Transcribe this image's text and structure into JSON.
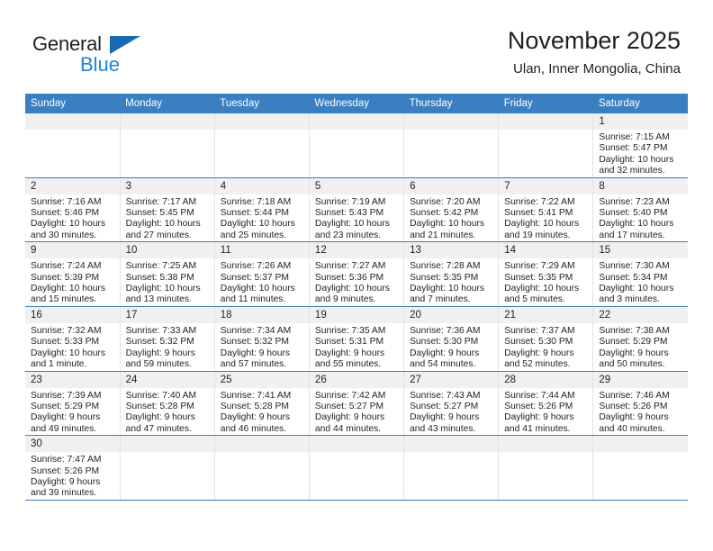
{
  "brand": {
    "name_dark": "General",
    "name_blue": "Blue",
    "accent_blue": "#1869b0",
    "light_blue": "#1f86d0"
  },
  "header": {
    "title": "November 2025",
    "subtitle": "Ulan, Inner Mongolia, China"
  },
  "theme": {
    "header_row_bg": "#3a7fc1",
    "daynum_bg": "#f0f0f0",
    "text": "#231f20"
  },
  "weekdays": [
    "Sunday",
    "Monday",
    "Tuesday",
    "Wednesday",
    "Thursday",
    "Friday",
    "Saturday"
  ],
  "weeks": [
    [
      {
        "day": "",
        "empty": true,
        "sunrise": "",
        "sunset": "",
        "daylight1": "",
        "daylight2": ""
      },
      {
        "day": "",
        "empty": true,
        "sunrise": "",
        "sunset": "",
        "daylight1": "",
        "daylight2": ""
      },
      {
        "day": "",
        "empty": true,
        "sunrise": "",
        "sunset": "",
        "daylight1": "",
        "daylight2": ""
      },
      {
        "day": "",
        "empty": true,
        "sunrise": "",
        "sunset": "",
        "daylight1": "",
        "daylight2": ""
      },
      {
        "day": "",
        "empty": true,
        "sunrise": "",
        "sunset": "",
        "daylight1": "",
        "daylight2": ""
      },
      {
        "day": "",
        "empty": true,
        "sunrise": "",
        "sunset": "",
        "daylight1": "",
        "daylight2": ""
      },
      {
        "day": "1",
        "sunrise": "Sunrise: 7:15 AM",
        "sunset": "Sunset: 5:47 PM",
        "daylight1": "Daylight: 10 hours",
        "daylight2": "and 32 minutes."
      }
    ],
    [
      {
        "day": "2",
        "sunrise": "Sunrise: 7:16 AM",
        "sunset": "Sunset: 5:46 PM",
        "daylight1": "Daylight: 10 hours",
        "daylight2": "and 30 minutes."
      },
      {
        "day": "3",
        "sunrise": "Sunrise: 7:17 AM",
        "sunset": "Sunset: 5:45 PM",
        "daylight1": "Daylight: 10 hours",
        "daylight2": "and 27 minutes."
      },
      {
        "day": "4",
        "sunrise": "Sunrise: 7:18 AM",
        "sunset": "Sunset: 5:44 PM",
        "daylight1": "Daylight: 10 hours",
        "daylight2": "and 25 minutes."
      },
      {
        "day": "5",
        "sunrise": "Sunrise: 7:19 AM",
        "sunset": "Sunset: 5:43 PM",
        "daylight1": "Daylight: 10 hours",
        "daylight2": "and 23 minutes."
      },
      {
        "day": "6",
        "sunrise": "Sunrise: 7:20 AM",
        "sunset": "Sunset: 5:42 PM",
        "daylight1": "Daylight: 10 hours",
        "daylight2": "and 21 minutes."
      },
      {
        "day": "7",
        "sunrise": "Sunrise: 7:22 AM",
        "sunset": "Sunset: 5:41 PM",
        "daylight1": "Daylight: 10 hours",
        "daylight2": "and 19 minutes."
      },
      {
        "day": "8",
        "sunrise": "Sunrise: 7:23 AM",
        "sunset": "Sunset: 5:40 PM",
        "daylight1": "Daylight: 10 hours",
        "daylight2": "and 17 minutes."
      }
    ],
    [
      {
        "day": "9",
        "sunrise": "Sunrise: 7:24 AM",
        "sunset": "Sunset: 5:39 PM",
        "daylight1": "Daylight: 10 hours",
        "daylight2": "and 15 minutes."
      },
      {
        "day": "10",
        "sunrise": "Sunrise: 7:25 AM",
        "sunset": "Sunset: 5:38 PM",
        "daylight1": "Daylight: 10 hours",
        "daylight2": "and 13 minutes."
      },
      {
        "day": "11",
        "sunrise": "Sunrise: 7:26 AM",
        "sunset": "Sunset: 5:37 PM",
        "daylight1": "Daylight: 10 hours",
        "daylight2": "and 11 minutes."
      },
      {
        "day": "12",
        "sunrise": "Sunrise: 7:27 AM",
        "sunset": "Sunset: 5:36 PM",
        "daylight1": "Daylight: 10 hours",
        "daylight2": "and 9 minutes."
      },
      {
        "day": "13",
        "sunrise": "Sunrise: 7:28 AM",
        "sunset": "Sunset: 5:35 PM",
        "daylight1": "Daylight: 10 hours",
        "daylight2": "and 7 minutes."
      },
      {
        "day": "14",
        "sunrise": "Sunrise: 7:29 AM",
        "sunset": "Sunset: 5:35 PM",
        "daylight1": "Daylight: 10 hours",
        "daylight2": "and 5 minutes."
      },
      {
        "day": "15",
        "sunrise": "Sunrise: 7:30 AM",
        "sunset": "Sunset: 5:34 PM",
        "daylight1": "Daylight: 10 hours",
        "daylight2": "and 3 minutes."
      }
    ],
    [
      {
        "day": "16",
        "sunrise": "Sunrise: 7:32 AM",
        "sunset": "Sunset: 5:33 PM",
        "daylight1": "Daylight: 10 hours",
        "daylight2": "and 1 minute."
      },
      {
        "day": "17",
        "sunrise": "Sunrise: 7:33 AM",
        "sunset": "Sunset: 5:32 PM",
        "daylight1": "Daylight: 9 hours",
        "daylight2": "and 59 minutes."
      },
      {
        "day": "18",
        "sunrise": "Sunrise: 7:34 AM",
        "sunset": "Sunset: 5:32 PM",
        "daylight1": "Daylight: 9 hours",
        "daylight2": "and 57 minutes."
      },
      {
        "day": "19",
        "sunrise": "Sunrise: 7:35 AM",
        "sunset": "Sunset: 5:31 PM",
        "daylight1": "Daylight: 9 hours",
        "daylight2": "and 55 minutes."
      },
      {
        "day": "20",
        "sunrise": "Sunrise: 7:36 AM",
        "sunset": "Sunset: 5:30 PM",
        "daylight1": "Daylight: 9 hours",
        "daylight2": "and 54 minutes."
      },
      {
        "day": "21",
        "sunrise": "Sunrise: 7:37 AM",
        "sunset": "Sunset: 5:30 PM",
        "daylight1": "Daylight: 9 hours",
        "daylight2": "and 52 minutes."
      },
      {
        "day": "22",
        "sunrise": "Sunrise: 7:38 AM",
        "sunset": "Sunset: 5:29 PM",
        "daylight1": "Daylight: 9 hours",
        "daylight2": "and 50 minutes."
      }
    ],
    [
      {
        "day": "23",
        "sunrise": "Sunrise: 7:39 AM",
        "sunset": "Sunset: 5:29 PM",
        "daylight1": "Daylight: 9 hours",
        "daylight2": "and 49 minutes."
      },
      {
        "day": "24",
        "sunrise": "Sunrise: 7:40 AM",
        "sunset": "Sunset: 5:28 PM",
        "daylight1": "Daylight: 9 hours",
        "daylight2": "and 47 minutes."
      },
      {
        "day": "25",
        "sunrise": "Sunrise: 7:41 AM",
        "sunset": "Sunset: 5:28 PM",
        "daylight1": "Daylight: 9 hours",
        "daylight2": "and 46 minutes."
      },
      {
        "day": "26",
        "sunrise": "Sunrise: 7:42 AM",
        "sunset": "Sunset: 5:27 PM",
        "daylight1": "Daylight: 9 hours",
        "daylight2": "and 44 minutes."
      },
      {
        "day": "27",
        "sunrise": "Sunrise: 7:43 AM",
        "sunset": "Sunset: 5:27 PM",
        "daylight1": "Daylight: 9 hours",
        "daylight2": "and 43 minutes."
      },
      {
        "day": "28",
        "sunrise": "Sunrise: 7:44 AM",
        "sunset": "Sunset: 5:26 PM",
        "daylight1": "Daylight: 9 hours",
        "daylight2": "and 41 minutes."
      },
      {
        "day": "29",
        "sunrise": "Sunrise: 7:46 AM",
        "sunset": "Sunset: 5:26 PM",
        "daylight1": "Daylight: 9 hours",
        "daylight2": "and 40 minutes."
      }
    ],
    [
      {
        "day": "30",
        "sunrise": "Sunrise: 7:47 AM",
        "sunset": "Sunset: 5:26 PM",
        "daylight1": "Daylight: 9 hours",
        "daylight2": "and 39 minutes."
      },
      {
        "day": "",
        "empty": true,
        "sunrise": "",
        "sunset": "",
        "daylight1": "",
        "daylight2": ""
      },
      {
        "day": "",
        "empty": true,
        "sunrise": "",
        "sunset": "",
        "daylight1": "",
        "daylight2": ""
      },
      {
        "day": "",
        "empty": true,
        "sunrise": "",
        "sunset": "",
        "daylight1": "",
        "daylight2": ""
      },
      {
        "day": "",
        "empty": true,
        "sunrise": "",
        "sunset": "",
        "daylight1": "",
        "daylight2": ""
      },
      {
        "day": "",
        "empty": true,
        "sunrise": "",
        "sunset": "",
        "daylight1": "",
        "daylight2": ""
      },
      {
        "day": "",
        "empty": true,
        "sunrise": "",
        "sunset": "",
        "daylight1": "",
        "daylight2": ""
      }
    ]
  ]
}
